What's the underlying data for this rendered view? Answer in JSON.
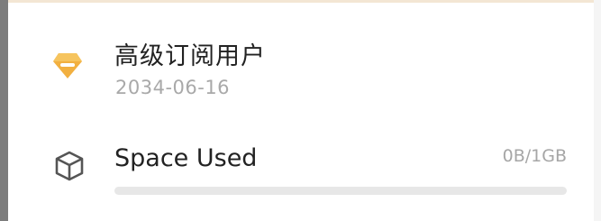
{
  "subscription": {
    "plan_label": "高级订阅用户",
    "expiry_date": "2034-06-16",
    "icon": "diamond-icon",
    "icon_color": "#f2b040"
  },
  "storage": {
    "label": "Space Used",
    "usage_text": "0B/1GB",
    "icon": "box-icon",
    "used_fraction": 0
  }
}
